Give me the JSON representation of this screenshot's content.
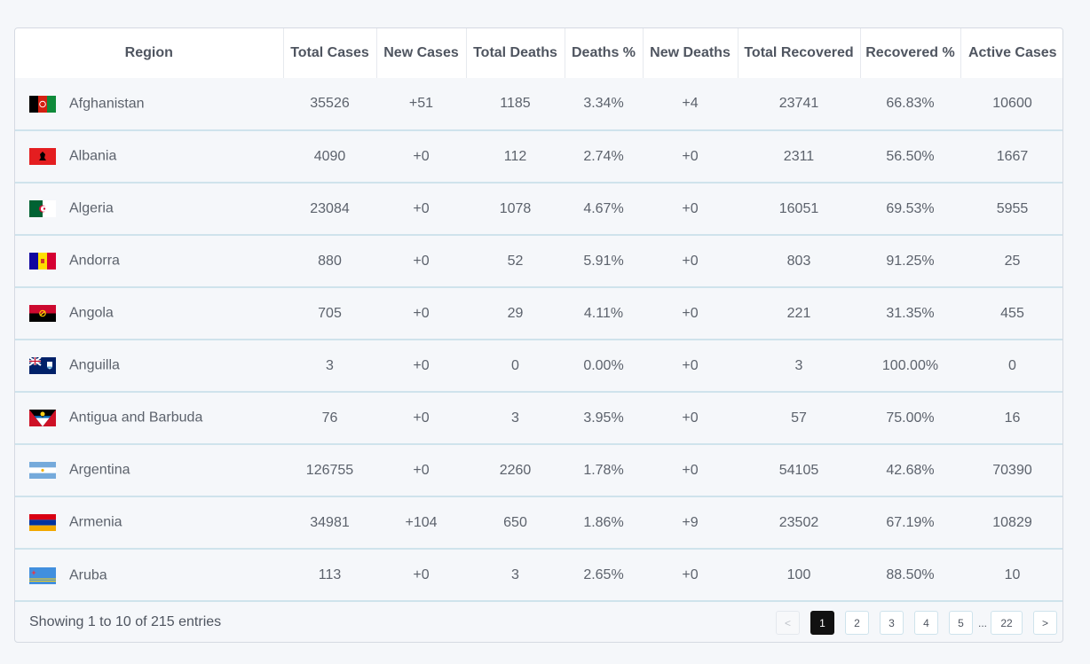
{
  "table": {
    "headers": [
      "Region",
      "Total Cases",
      "New Cases",
      "Total Deaths",
      "Deaths %",
      "New Deaths",
      "Total Recovered",
      "Recovered %",
      "Active Cases"
    ],
    "rows": [
      {
        "flag": "afghanistan-flag-icon",
        "region": "Afghanistan",
        "total_cases": "35526",
        "new_cases": "+51",
        "total_deaths": "1185",
        "deaths_pct": "3.34%",
        "new_deaths": "+4",
        "total_recovered": "23741",
        "recovered_pct": "66.83%",
        "active_cases": "10600"
      },
      {
        "flag": "albania-flag-icon",
        "region": "Albania",
        "total_cases": "4090",
        "new_cases": "+0",
        "total_deaths": "112",
        "deaths_pct": "2.74%",
        "new_deaths": "+0",
        "total_recovered": "2311",
        "recovered_pct": "56.50%",
        "active_cases": "1667"
      },
      {
        "flag": "algeria-flag-icon",
        "region": "Algeria",
        "total_cases": "23084",
        "new_cases": "+0",
        "total_deaths": "1078",
        "deaths_pct": "4.67%",
        "new_deaths": "+0",
        "total_recovered": "16051",
        "recovered_pct": "69.53%",
        "active_cases": "5955"
      },
      {
        "flag": "andorra-flag-icon",
        "region": "Andorra",
        "total_cases": "880",
        "new_cases": "+0",
        "total_deaths": "52",
        "deaths_pct": "5.91%",
        "new_deaths": "+0",
        "total_recovered": "803",
        "recovered_pct": "91.25%",
        "active_cases": "25"
      },
      {
        "flag": "angola-flag-icon",
        "region": "Angola",
        "total_cases": "705",
        "new_cases": "+0",
        "total_deaths": "29",
        "deaths_pct": "4.11%",
        "new_deaths": "+0",
        "total_recovered": "221",
        "recovered_pct": "31.35%",
        "active_cases": "455"
      },
      {
        "flag": "anguilla-flag-icon",
        "region": "Anguilla",
        "total_cases": "3",
        "new_cases": "+0",
        "total_deaths": "0",
        "deaths_pct": "0.00%",
        "new_deaths": "+0",
        "total_recovered": "3",
        "recovered_pct": "100.00%",
        "active_cases": "0"
      },
      {
        "flag": "antigua-and-barbuda-flag-icon",
        "region": "Antigua and Barbuda",
        "total_cases": "76",
        "new_cases": "+0",
        "total_deaths": "3",
        "deaths_pct": "3.95%",
        "new_deaths": "+0",
        "total_recovered": "57",
        "recovered_pct": "75.00%",
        "active_cases": "16"
      },
      {
        "flag": "argentina-flag-icon",
        "region": "Argentina",
        "total_cases": "126755",
        "new_cases": "+0",
        "total_deaths": "2260",
        "deaths_pct": "1.78%",
        "new_deaths": "+0",
        "total_recovered": "54105",
        "recovered_pct": "42.68%",
        "active_cases": "70390"
      },
      {
        "flag": "armenia-flag-icon",
        "region": "Armenia",
        "total_cases": "34981",
        "new_cases": "+104",
        "total_deaths": "650",
        "deaths_pct": "1.86%",
        "new_deaths": "+9",
        "total_recovered": "23502",
        "recovered_pct": "67.19%",
        "active_cases": "10829"
      },
      {
        "flag": "aruba-flag-icon",
        "region": "Aruba",
        "total_cases": "113",
        "new_cases": "+0",
        "total_deaths": "3",
        "deaths_pct": "2.65%",
        "new_deaths": "+0",
        "total_recovered": "100",
        "recovered_pct": "88.50%",
        "active_cases": "10"
      }
    ]
  },
  "footer": {
    "entries_text": "Showing 1 to 10 of 215 entries"
  },
  "pagination": {
    "prev": "<",
    "pages": [
      "1",
      "2",
      "3",
      "4",
      "5"
    ],
    "active_page": "1",
    "ellipsis": "...",
    "last": "22",
    "next": ">"
  },
  "colors": {
    "row_border": "#cfe3ec",
    "active_page_bg": "#111111",
    "background": "#f5f7fa"
  }
}
